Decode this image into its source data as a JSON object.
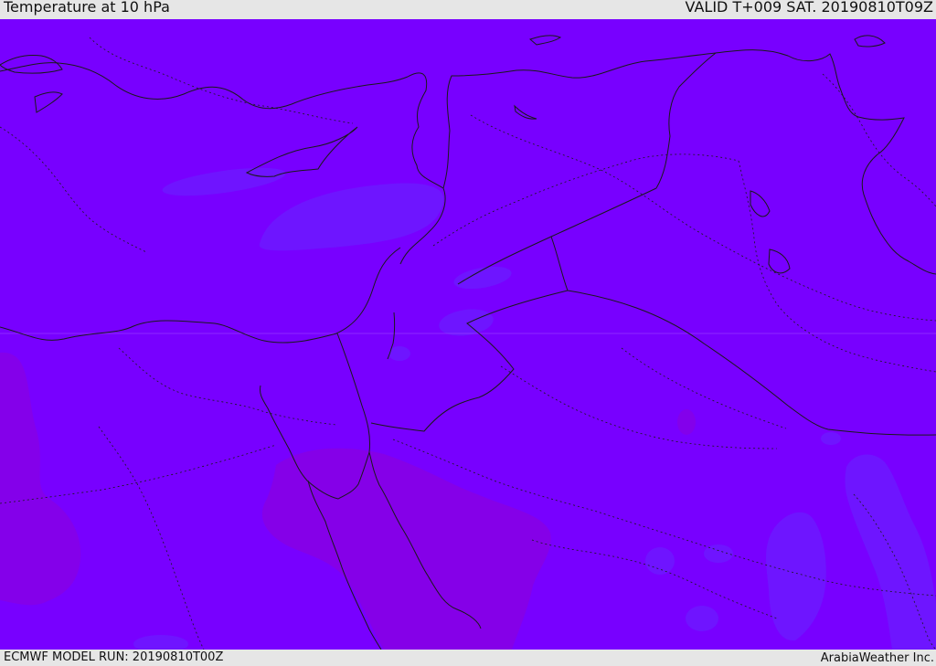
{
  "header": {
    "title": "Temperature at 10 hPa",
    "valid": "VALID T+009 SAT. 20190810T09Z"
  },
  "footer": {
    "model_run": "ECMWF MODEL RUN: 20190810T00Z",
    "brand": "ArabiaWeather Inc."
  },
  "map": {
    "region": "Eastern Mediterranean and Middle East",
    "colors": {
      "base": "#7800ff",
      "cool_patch": "#6b1cff",
      "warm_patch": "#8600e6",
      "border": "#1a1a1a"
    }
  }
}
